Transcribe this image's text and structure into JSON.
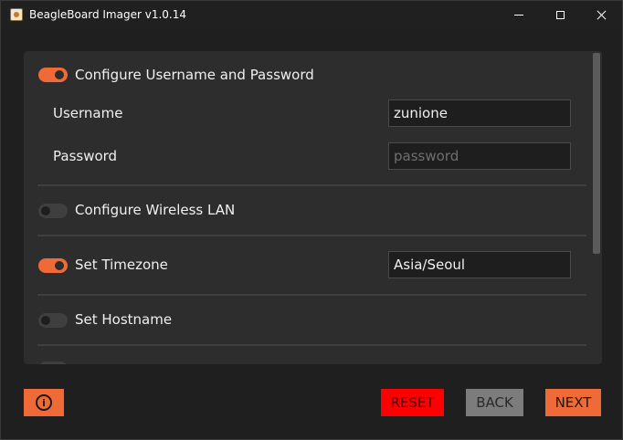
{
  "window": {
    "title": "BeagleBoard Imager v1.0.14"
  },
  "settings": {
    "credentials": {
      "label": "Configure Username and Password",
      "enabled": true,
      "username_label": "Username",
      "username_value": "zunione",
      "password_label": "Password",
      "password_placeholder": "password"
    },
    "wireless": {
      "label": "Configure Wireless LAN",
      "enabled": false
    },
    "timezone": {
      "label": "Set Timezone",
      "enabled": true,
      "value": "Asia/Seoul"
    },
    "hostname": {
      "label": "Set Hostname",
      "enabled": false
    }
  },
  "buttons": {
    "info_icon": "i",
    "reset": "RESET",
    "back": "BACK",
    "next": "NEXT"
  },
  "colors": {
    "accent": "#ef6a36",
    "reset": "#ff0000",
    "disabled": "#7c7c7c"
  }
}
